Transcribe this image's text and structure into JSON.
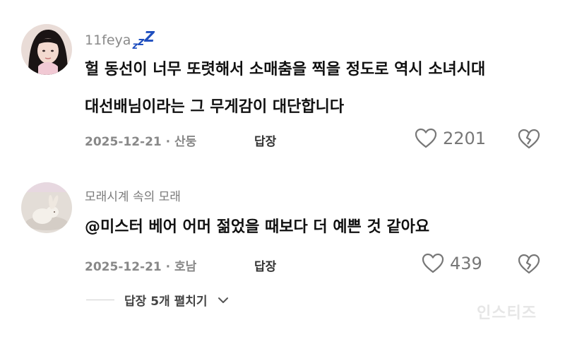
{
  "comments": [
    {
      "username": "11feya",
      "badge": "zzZ",
      "lines": [
        "헐 동선이 너무 또렷해서 소매춤을 찍을 정도로 역시 소녀시대",
        "대선배님이라는 그 무게감이 대단합니다"
      ],
      "date": "2025-12-21",
      "location": "산둥",
      "reply_label": "답장",
      "likes": "2201"
    },
    {
      "username": "모래시계 속의 모래",
      "lines": [
        "@미스터 베어 어머 젊었을 때보다 더 예쁜 것 같아요"
      ],
      "date": "2025-12-21",
      "location": "호남",
      "reply_label": "답장",
      "likes": "439"
    }
  ],
  "thread": {
    "more_replies_label": "답장 5개 펼치기"
  },
  "watermark": "인스티즈",
  "icons": {
    "like": "heart-outline-icon",
    "dislike": "broken-heart-icon",
    "expand": "chevron-down-icon"
  },
  "colors": {
    "badge": "#1f4fbf",
    "meta": "#888888",
    "text": "#111111"
  }
}
